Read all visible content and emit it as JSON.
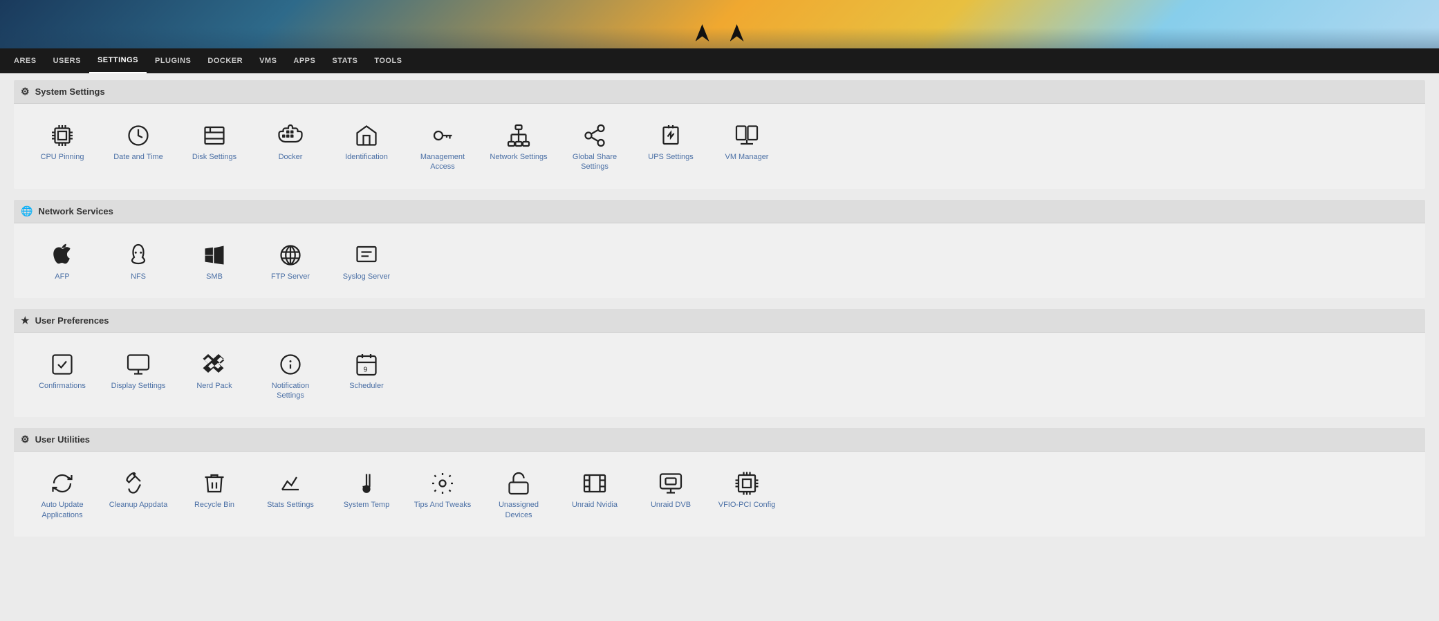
{
  "nav": {
    "items": [
      {
        "label": "ARES",
        "active": false
      },
      {
        "label": "USERS",
        "active": false
      },
      {
        "label": "SETTINGS",
        "active": true
      },
      {
        "label": "PLUGINS",
        "active": false
      },
      {
        "label": "DOCKER",
        "active": false
      },
      {
        "label": "VMS",
        "active": false
      },
      {
        "label": "APPS",
        "active": false
      },
      {
        "label": "STATS",
        "active": false
      },
      {
        "label": "TOOLS",
        "active": false
      }
    ]
  },
  "sections": [
    {
      "id": "system-settings",
      "icon": "gear",
      "title": "System Settings",
      "items": [
        {
          "id": "cpu-pinning",
          "label": "CPU Pinning",
          "icon": "cpu"
        },
        {
          "id": "date-and-time",
          "label": "Date and Time",
          "icon": "clock"
        },
        {
          "id": "disk-settings",
          "label": "Disk Settings",
          "icon": "disk"
        },
        {
          "id": "docker",
          "label": "Docker",
          "icon": "docker"
        },
        {
          "id": "identification",
          "label": "Identification",
          "icon": "home"
        },
        {
          "id": "management-access",
          "label": "Management Access",
          "icon": "key"
        },
        {
          "id": "network-settings",
          "label": "Network Settings",
          "icon": "network"
        },
        {
          "id": "global-share-settings",
          "label": "Global Share Settings",
          "icon": "share"
        },
        {
          "id": "ups-settings",
          "label": "UPS Settings",
          "icon": "ups"
        },
        {
          "id": "vm-manager",
          "label": "VM Manager",
          "icon": "vm"
        }
      ]
    },
    {
      "id": "network-services",
      "icon": "globe",
      "title": "Network Services",
      "items": [
        {
          "id": "afp",
          "label": "AFP",
          "icon": "apple"
        },
        {
          "id": "nfs",
          "label": "NFS",
          "icon": "linux"
        },
        {
          "id": "smb",
          "label": "SMB",
          "icon": "windows"
        },
        {
          "id": "ftp-server",
          "label": "FTP Server",
          "icon": "ftp"
        },
        {
          "id": "syslog-server",
          "label": "Syslog Server",
          "icon": "syslog"
        }
      ]
    },
    {
      "id": "user-preferences",
      "icon": "star",
      "title": "User Preferences",
      "items": [
        {
          "id": "confirmations",
          "label": "Confirmations",
          "icon": "check"
        },
        {
          "id": "display-settings",
          "label": "Display Settings",
          "icon": "display"
        },
        {
          "id": "nerd-pack",
          "label": "Nerd Pack",
          "icon": "dropbox"
        },
        {
          "id": "notification-settings",
          "label": "Notification Settings",
          "icon": "info"
        },
        {
          "id": "scheduler",
          "label": "Scheduler",
          "icon": "calendar"
        }
      ]
    },
    {
      "id": "user-utilities",
      "icon": "gear",
      "title": "User Utilities",
      "items": [
        {
          "id": "auto-update-applications",
          "label": "Auto Update Applications",
          "icon": "refresh"
        },
        {
          "id": "cleanup-appdata",
          "label": "Cleanup Appdata",
          "icon": "brush"
        },
        {
          "id": "recycle-bin",
          "label": "Recycle Bin",
          "icon": "trash"
        },
        {
          "id": "stats-settings",
          "label": "Stats Settings",
          "icon": "stats"
        },
        {
          "id": "system-temp",
          "label": "System Temp",
          "icon": "temp"
        },
        {
          "id": "tips-and-tweaks",
          "label": "Tips And Tweaks",
          "icon": "gear2"
        },
        {
          "id": "unassigned-devices",
          "label": "Unassigned Devices",
          "icon": "unlock"
        },
        {
          "id": "unraid-nvidia",
          "label": "Unraid Nvidia",
          "icon": "film"
        },
        {
          "id": "unraid-dvb",
          "label": "Unraid DVB",
          "icon": "monitor"
        },
        {
          "id": "vfio-pci-config",
          "label": "VFIO-PCI Config",
          "icon": "chip"
        }
      ]
    }
  ]
}
